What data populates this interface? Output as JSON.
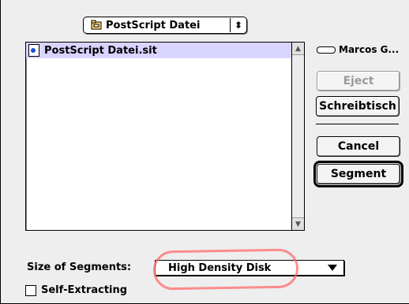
{
  "dialog": {
    "folder_popup": {
      "label": "PostScript Datei",
      "icon": "folder-disk-icon",
      "arrows": "⬍"
    },
    "file_list": {
      "items": [
        {
          "name": "PostScript Datei.sit",
          "icon": "stuffit-file-icon",
          "selected": true
        }
      ]
    },
    "disk": {
      "name": "Marcos G..."
    },
    "buttons": {
      "eject": "Eject",
      "desktop": "Schreibtisch",
      "cancel": "Cancel",
      "segment": "Segment"
    },
    "options": {
      "size_label": "Size of Segments:",
      "size_value": "High Density Disk",
      "self_extract_label": "Self-Extracting",
      "self_extract_checked": false
    }
  }
}
